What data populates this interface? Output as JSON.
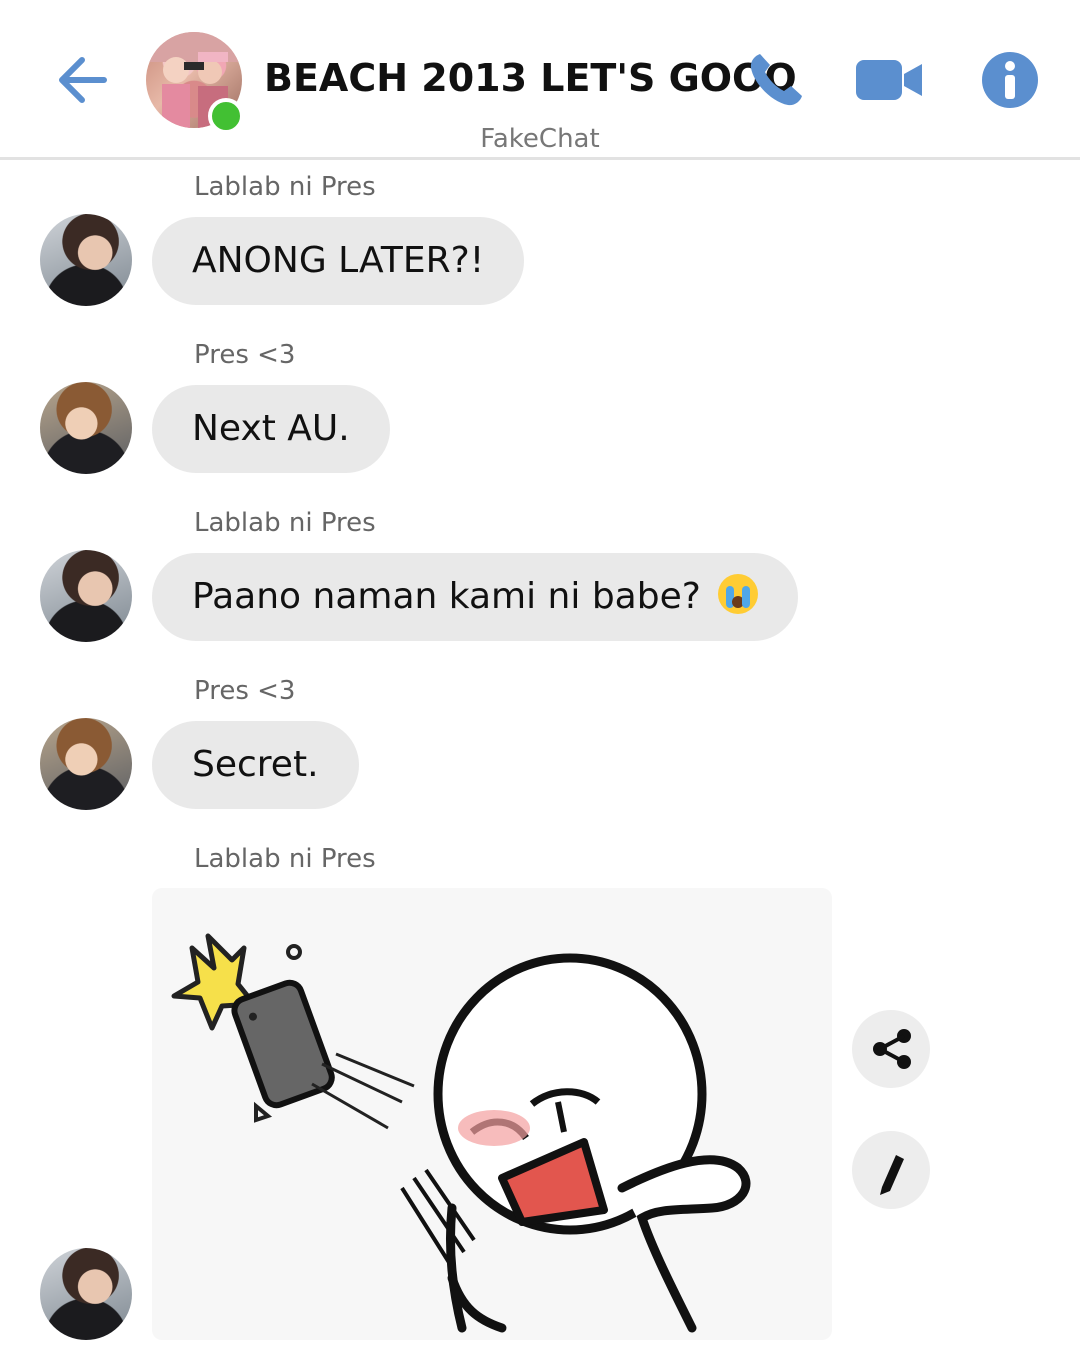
{
  "header": {
    "title": "BEACH 2013 LET'S GOOO",
    "app_name": "FakeChat",
    "accent_color": "#5b8fcf",
    "online_status": "online",
    "icons": [
      "back-arrow-icon",
      "phone-icon",
      "video-camera-icon",
      "info-icon"
    ]
  },
  "messages": [
    {
      "sender": "Lablab ni Pres",
      "text": "ANONG LATER?!"
    },
    {
      "sender": "Pres <3",
      "text": "Next AU."
    },
    {
      "sender": "Lablab ni Pres",
      "text": "Paano naman kami ni babe?",
      "emoji": "crying-face"
    },
    {
      "sender": "Pres <3",
      "text": "Secret."
    },
    {
      "sender": "Lablab ni Pres",
      "attachment": "sticker-throwing-phone"
    }
  ],
  "actions": {
    "icons": [
      "share-icon",
      "edit-pencil-icon"
    ]
  }
}
